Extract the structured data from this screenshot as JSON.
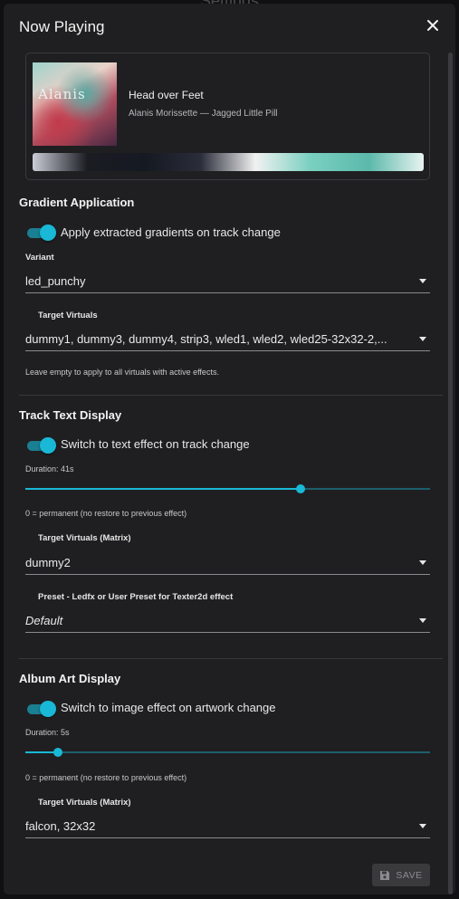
{
  "background": {
    "title": "Settings"
  },
  "dialog": {
    "title": "Now Playing",
    "close_icon": "close-icon"
  },
  "now_playing": {
    "album_art_text": "Alanis",
    "track_title": "Head over Feet",
    "track_subtitle": "Alanis Morissette — Jagged Little Pill",
    "gradient_colors": [
      "#c9ccd6",
      "#1a1c22",
      "#151922",
      "#2a2d3a",
      "#f1f1f1",
      "#7ad0c0",
      "#5bb9ab",
      "#e8f3f0"
    ]
  },
  "gradient_application": {
    "title": "Gradient Application",
    "toggle_label": "Apply extracted gradients on track change",
    "toggle_on": true,
    "variant_label": "Variant",
    "variant_value": "led_punchy",
    "targets_label": "Target Virtuals",
    "targets_value": "dummy1, dummy3, dummy4, strip3, wled1, wled2, wled25-32x32-2,...",
    "helper": "Leave empty to apply to all virtuals with active effects."
  },
  "track_text_display": {
    "title": "Track Text Display",
    "toggle_label": "Switch to text effect on track change",
    "toggle_on": true,
    "duration_label": "Duration: 41s",
    "duration_fraction": 0.68,
    "helper": "0 = permanent (no restore to previous effect)",
    "targets_label": "Target Virtuals (Matrix)",
    "targets_value": "dummy2",
    "preset_label": "Preset - Ledfx or User Preset for Texter2d effect",
    "preset_value": "Default"
  },
  "album_art_display": {
    "title": "Album Art Display",
    "toggle_label": "Switch to image effect on artwork change",
    "toggle_on": true,
    "duration_label": "Duration: 5s",
    "duration_fraction": 0.08,
    "helper": "0 = permanent (no restore to previous effect)",
    "targets_label": "Target Virtuals (Matrix)",
    "targets_value": "falcon, 32x32"
  },
  "footer": {
    "save_label": "SAVE",
    "save_icon": "save-icon",
    "save_disabled": true
  },
  "colors": {
    "accent": "#19b8d6",
    "dialog_bg": "#1f1f21"
  }
}
